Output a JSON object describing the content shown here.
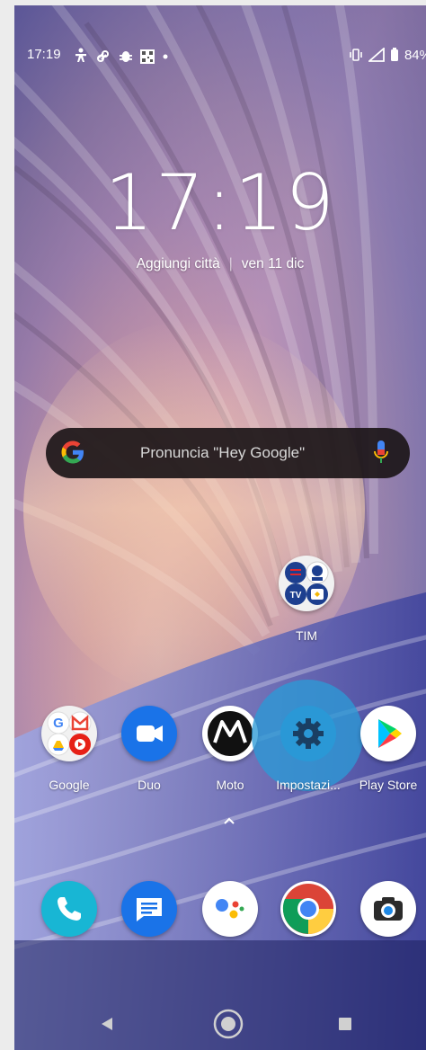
{
  "status_bar": {
    "time": "17:19",
    "notif_icons": [
      "accessibility-icon",
      "link-icon",
      "bug-icon",
      "qr-icon",
      "dot-icon"
    ],
    "right_icons": [
      "vibrate-icon",
      "signal-icon",
      "battery-icon"
    ],
    "battery": "84%"
  },
  "clock": {
    "time": "17:19"
  },
  "date_line": {
    "city": "Aggiungi città",
    "separator": "|",
    "date": "ven 11 dic"
  },
  "search": {
    "hint": "Pronuncia \"Hey Google\""
  },
  "home": {
    "folder_tim": {
      "label": "TIM"
    }
  },
  "apps_row": [
    {
      "label": "Google"
    },
    {
      "label": "Duo"
    },
    {
      "label": "Moto"
    },
    {
      "label": "Impostazi..."
    },
    {
      "label": "Play Store"
    }
  ],
  "dock": [
    "phone-icon",
    "messages-icon",
    "assistant-icon",
    "chrome-icon",
    "camera-icon"
  ],
  "nav": [
    "back-button",
    "home-button",
    "recents-button"
  ],
  "colors": {
    "search_bg": "#1c1618",
    "duo_blue": "#1a73e8",
    "highlight": "#2c9ad6"
  }
}
